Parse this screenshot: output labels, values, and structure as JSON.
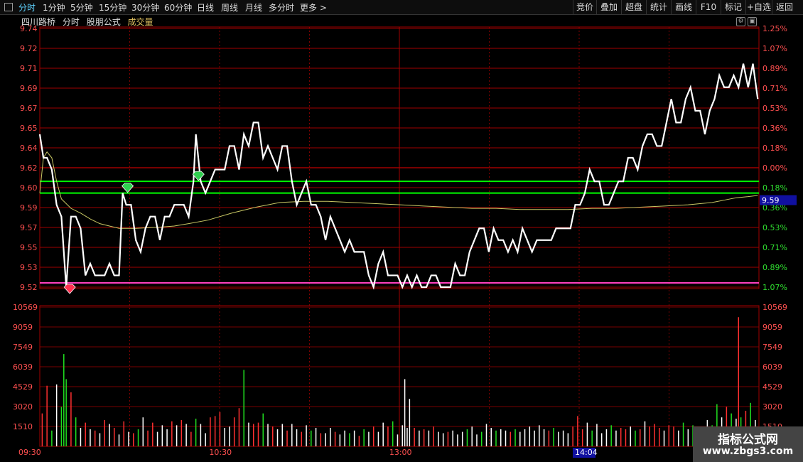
{
  "toolbar": {
    "tabs": [
      "分时",
      "1分钟",
      "5分钟",
      "15分钟",
      "30分钟",
      "60分钟",
      "日线",
      "周线",
      "月线",
      "多分时",
      "更多 >"
    ],
    "right_buttons": [
      "竞价",
      "叠加",
      "超盘",
      "统计",
      "画线",
      "F10",
      "标记",
      "+自选",
      "返回"
    ]
  },
  "title": {
    "stock": "四川路桥",
    "mode": "分时",
    "formula": "股朋公式",
    "volume_label": "成交量"
  },
  "colors": {
    "price_line": "#ffffff",
    "avg_line": "#c8c864",
    "grid_red": "#a00000",
    "axis_red": "#ff4040",
    "support_green": "#00ff00",
    "support_magenta": "#ff40c0",
    "vol_red": "#ff3030",
    "vol_green": "#20e020",
    "vol_white": "#ffffff",
    "current_price_box": "#1010a0"
  },
  "icons": {
    "up_marker": "green-diamond-icon",
    "down_marker": "red-diamond-icon"
  },
  "chart_data": {
    "type": "line",
    "price_axis_labels": [
      "9.74",
      "9.72",
      "9.71",
      "9.69",
      "9.67",
      "9.65",
      "9.64",
      "9.62",
      "9.60",
      "9.59",
      "9.57",
      "9.55",
      "9.53",
      "9.52"
    ],
    "pct_axis_labels": [
      "1.25%",
      "1.07%",
      "0.89%",
      "0.71%",
      "0.53%",
      "0.36%",
      "0.18%",
      "0.00%",
      "0.18%",
      "0.36%",
      "0.53%",
      "0.71%",
      "0.89%",
      "1.07%"
    ],
    "volume_axis_labels": [
      "10569",
      "9059",
      "7549",
      "6039",
      "4529",
      "3020",
      "1510"
    ],
    "ylim": [
      9.52,
      9.74
    ],
    "volume_max": 10569,
    "time_labels": [
      "09:30",
      "10:30",
      "13:00",
      "14:04"
    ],
    "current_price": "9.59",
    "green_lines": [
      9.61,
      9.6
    ],
    "magenta_line": 9.52,
    "price_series": [
      [
        0,
        9.65
      ],
      [
        3,
        9.63
      ],
      [
        6,
        9.63
      ],
      [
        10,
        9.62
      ],
      [
        14,
        9.59
      ],
      [
        18,
        9.58
      ],
      [
        22,
        9.52
      ],
      [
        26,
        9.58
      ],
      [
        30,
        9.58
      ],
      [
        34,
        9.57
      ],
      [
        38,
        9.53
      ],
      [
        42,
        9.54
      ],
      [
        46,
        9.53
      ],
      [
        50,
        9.53
      ],
      [
        54,
        9.53
      ],
      [
        58,
        9.54
      ],
      [
        62,
        9.53
      ],
      [
        66,
        9.53
      ],
      [
        69,
        9.6
      ],
      [
        72,
        9.59
      ],
      [
        76,
        9.59
      ],
      [
        80,
        9.56
      ],
      [
        84,
        9.55
      ],
      [
        88,
        9.57
      ],
      [
        92,
        9.58
      ],
      [
        96,
        9.58
      ],
      [
        100,
        9.56
      ],
      [
        104,
        9.58
      ],
      [
        108,
        9.58
      ],
      [
        112,
        9.59
      ],
      [
        116,
        9.59
      ],
      [
        120,
        9.59
      ],
      [
        124,
        9.58
      ],
      [
        128,
        9.61
      ],
      [
        130,
        9.65
      ],
      [
        134,
        9.61
      ],
      [
        138,
        9.6
      ],
      [
        142,
        9.61
      ],
      [
        146,
        9.62
      ],
      [
        150,
        9.62
      ],
      [
        154,
        9.62
      ],
      [
        158,
        9.64
      ],
      [
        162,
        9.64
      ],
      [
        166,
        9.62
      ],
      [
        170,
        9.65
      ],
      [
        174,
        9.64
      ],
      [
        178,
        9.66
      ],
      [
        182,
        9.66
      ],
      [
        186,
        9.63
      ],
      [
        190,
        9.64
      ],
      [
        194,
        9.63
      ],
      [
        198,
        9.62
      ],
      [
        202,
        9.64
      ],
      [
        206,
        9.64
      ],
      [
        210,
        9.61
      ],
      [
        214,
        9.59
      ],
      [
        218,
        9.6
      ],
      [
        222,
        9.61
      ],
      [
        226,
        9.59
      ],
      [
        230,
        9.59
      ],
      [
        234,
        9.58
      ],
      [
        238,
        9.56
      ],
      [
        242,
        9.58
      ],
      [
        246,
        9.57
      ],
      [
        250,
        9.56
      ],
      [
        254,
        9.55
      ],
      [
        258,
        9.56
      ],
      [
        262,
        9.55
      ],
      [
        266,
        9.55
      ],
      [
        270,
        9.55
      ],
      [
        274,
        9.53
      ],
      [
        278,
        9.52
      ],
      [
        282,
        9.54
      ],
      [
        286,
        9.55
      ],
      [
        290,
        9.53
      ],
      [
        294,
        9.53
      ],
      [
        298,
        9.53
      ],
      [
        302,
        9.52
      ],
      [
        306,
        9.53
      ],
      [
        310,
        9.52
      ],
      [
        314,
        9.53
      ],
      [
        318,
        9.52
      ],
      [
        322,
        9.52
      ],
      [
        326,
        9.53
      ],
      [
        330,
        9.53
      ],
      [
        334,
        9.52
      ],
      [
        338,
        9.52
      ],
      [
        342,
        9.52
      ],
      [
        346,
        9.54
      ],
      [
        350,
        9.53
      ],
      [
        354,
        9.53
      ],
      [
        358,
        9.55
      ],
      [
        362,
        9.56
      ],
      [
        366,
        9.57
      ],
      [
        370,
        9.57
      ],
      [
        374,
        9.55
      ],
      [
        378,
        9.57
      ],
      [
        382,
        9.56
      ],
      [
        386,
        9.56
      ],
      [
        390,
        9.55
      ],
      [
        394,
        9.56
      ],
      [
        398,
        9.55
      ],
      [
        402,
        9.57
      ],
      [
        406,
        9.56
      ],
      [
        410,
        9.55
      ],
      [
        414,
        9.56
      ],
      [
        418,
        9.56
      ],
      [
        422,
        9.56
      ],
      [
        426,
        9.56
      ],
      [
        430,
        9.57
      ],
      [
        434,
        9.57
      ],
      [
        438,
        9.57
      ],
      [
        442,
        9.57
      ],
      [
        446,
        9.59
      ],
      [
        450,
        9.59
      ],
      [
        454,
        9.6
      ],
      [
        458,
        9.62
      ],
      [
        462,
        9.61
      ],
      [
        466,
        9.61
      ],
      [
        470,
        9.59
      ],
      [
        474,
        9.59
      ],
      [
        478,
        9.6
      ],
      [
        482,
        9.61
      ],
      [
        486,
        9.61
      ],
      [
        490,
        9.63
      ],
      [
        494,
        9.63
      ],
      [
        498,
        9.62
      ],
      [
        502,
        9.64
      ],
      [
        506,
        9.65
      ],
      [
        510,
        9.65
      ],
      [
        514,
        9.64
      ],
      [
        518,
        9.64
      ],
      [
        522,
        9.66
      ],
      [
        526,
        9.68
      ],
      [
        530,
        9.66
      ],
      [
        534,
        9.66
      ],
      [
        538,
        9.68
      ],
      [
        542,
        9.69
      ],
      [
        546,
        9.67
      ],
      [
        550,
        9.67
      ],
      [
        554,
        9.65
      ],
      [
        558,
        9.67
      ],
      [
        562,
        9.68
      ],
      [
        566,
        9.7
      ],
      [
        570,
        9.69
      ],
      [
        574,
        9.69
      ],
      [
        578,
        9.7
      ],
      [
        582,
        9.69
      ],
      [
        586,
        9.71
      ],
      [
        590,
        9.69
      ],
      [
        594,
        9.71
      ],
      [
        598,
        9.68
      ]
    ],
    "avg_series": [
      [
        0,
        9.6
      ],
      [
        3,
        9.63
      ],
      [
        6,
        9.635
      ],
      [
        10,
        9.63
      ],
      [
        14,
        9.61
      ],
      [
        18,
        9.595
      ],
      [
        26,
        9.587
      ],
      [
        34,
        9.583
      ],
      [
        42,
        9.578
      ],
      [
        50,
        9.574
      ],
      [
        58,
        9.572
      ],
      [
        66,
        9.57
      ],
      [
        80,
        9.57
      ],
      [
        100,
        9.571
      ],
      [
        112,
        9.572
      ],
      [
        124,
        9.574
      ],
      [
        140,
        9.577
      ],
      [
        160,
        9.583
      ],
      [
        180,
        9.588
      ],
      [
        200,
        9.592
      ],
      [
        220,
        9.593
      ],
      [
        240,
        9.593
      ],
      [
        260,
        9.592
      ],
      [
        280,
        9.591
      ],
      [
        300,
        9.59
      ],
      [
        320,
        9.589
      ],
      [
        340,
        9.588
      ],
      [
        360,
        9.587
      ],
      [
        380,
        9.587
      ],
      [
        400,
        9.586
      ],
      [
        420,
        9.586
      ],
      [
        440,
        9.586
      ],
      [
        460,
        9.587
      ],
      [
        480,
        9.587
      ],
      [
        500,
        9.588
      ],
      [
        520,
        9.589
      ],
      [
        540,
        9.59
      ],
      [
        560,
        9.592
      ],
      [
        570,
        9.594
      ],
      [
        580,
        9.596
      ],
      [
        590,
        9.597
      ],
      [
        598,
        9.598
      ]
    ],
    "volume_bars": [
      [
        2,
        2500,
        "r"
      ],
      [
        6,
        4600,
        "r"
      ],
      [
        10,
        1200,
        "g"
      ],
      [
        14,
        4700,
        "w"
      ],
      [
        18,
        3000,
        "g"
      ],
      [
        20,
        7000,
        "g"
      ],
      [
        22,
        5100,
        "g"
      ],
      [
        26,
        4100,
        "r"
      ],
      [
        30,
        2200,
        "g"
      ],
      [
        34,
        1400,
        "w"
      ],
      [
        38,
        1800,
        "r"
      ],
      [
        42,
        1300,
        "w"
      ],
      [
        46,
        1200,
        "r"
      ],
      [
        50,
        1000,
        "w"
      ],
      [
        54,
        2000,
        "r"
      ],
      [
        58,
        1700,
        "w"
      ],
      [
        62,
        1400,
        "r"
      ],
      [
        66,
        900,
        "w"
      ],
      [
        70,
        1900,
        "r"
      ],
      [
        74,
        1100,
        "w"
      ],
      [
        78,
        1000,
        "r"
      ],
      [
        82,
        1300,
        "g"
      ],
      [
        86,
        2200,
        "w"
      ],
      [
        90,
        1200,
        "r"
      ],
      [
        94,
        1800,
        "r"
      ],
      [
        98,
        1100,
        "w"
      ],
      [
        102,
        1600,
        "w"
      ],
      [
        106,
        1300,
        "w"
      ],
      [
        110,
        1900,
        "r"
      ],
      [
        114,
        1600,
        "w"
      ],
      [
        118,
        2000,
        "r"
      ],
      [
        122,
        1700,
        "w"
      ],
      [
        126,
        1100,
        "r"
      ],
      [
        130,
        2100,
        "g"
      ],
      [
        134,
        1700,
        "w"
      ],
      [
        138,
        1000,
        "w"
      ],
      [
        142,
        2200,
        "r"
      ],
      [
        146,
        2300,
        "r"
      ],
      [
        150,
        2600,
        "r"
      ],
      [
        154,
        1400,
        "w"
      ],
      [
        158,
        1500,
        "w"
      ],
      [
        162,
        2200,
        "r"
      ],
      [
        166,
        2900,
        "r"
      ],
      [
        170,
        5800,
        "g"
      ],
      [
        174,
        1800,
        "w"
      ],
      [
        178,
        1700,
        "r"
      ],
      [
        182,
        1800,
        "r"
      ],
      [
        186,
        2500,
        "g"
      ],
      [
        190,
        1700,
        "w"
      ],
      [
        194,
        1500,
        "r"
      ],
      [
        198,
        1300,
        "w"
      ],
      [
        202,
        1700,
        "w"
      ],
      [
        206,
        1200,
        "r"
      ],
      [
        210,
        1700,
        "w"
      ],
      [
        214,
        1300,
        "w"
      ],
      [
        218,
        1100,
        "r"
      ],
      [
        222,
        1600,
        "w"
      ],
      [
        226,
        1200,
        "g"
      ],
      [
        230,
        1400,
        "w"
      ],
      [
        234,
        1000,
        "r"
      ],
      [
        238,
        1000,
        "w"
      ],
      [
        242,
        1400,
        "w"
      ],
      [
        246,
        1100,
        "r"
      ],
      [
        250,
        900,
        "w"
      ],
      [
        254,
        1200,
        "w"
      ],
      [
        258,
        1000,
        "g"
      ],
      [
        262,
        1200,
        "w"
      ],
      [
        266,
        800,
        "r"
      ],
      [
        270,
        1300,
        "g"
      ],
      [
        274,
        1100,
        "w"
      ],
      [
        278,
        1500,
        "r"
      ],
      [
        282,
        1100,
        "w"
      ],
      [
        286,
        1800,
        "w"
      ],
      [
        290,
        1500,
        "r"
      ],
      [
        294,
        1900,
        "g"
      ],
      [
        298,
        900,
        "w"
      ],
      [
        302,
        1600,
        "w"
      ],
      [
        304,
        5100,
        "w"
      ],
      [
        306,
        1400,
        "w"
      ],
      [
        308,
        3600,
        "w"
      ],
      [
        312,
        1400,
        "r"
      ],
      [
        316,
        1200,
        "w"
      ],
      [
        320,
        1300,
        "r"
      ],
      [
        324,
        1200,
        "w"
      ],
      [
        328,
        1500,
        "r"
      ],
      [
        332,
        1100,
        "w"
      ],
      [
        336,
        1000,
        "w"
      ],
      [
        340,
        1100,
        "r"
      ],
      [
        344,
        1200,
        "w"
      ],
      [
        348,
        900,
        "w"
      ],
      [
        352,
        1100,
        "w"
      ],
      [
        356,
        1300,
        "g"
      ],
      [
        360,
        1500,
        "w"
      ],
      [
        364,
        900,
        "w"
      ],
      [
        368,
        1100,
        "g"
      ],
      [
        372,
        1700,
        "w"
      ],
      [
        376,
        1400,
        "w"
      ],
      [
        380,
        1200,
        "g"
      ],
      [
        384,
        1300,
        "w"
      ],
      [
        388,
        1200,
        "w"
      ],
      [
        392,
        1100,
        "r"
      ],
      [
        396,
        1300,
        "g"
      ],
      [
        400,
        1100,
        "w"
      ],
      [
        404,
        1300,
        "w"
      ],
      [
        408,
        1500,
        "w"
      ],
      [
        412,
        1200,
        "w"
      ],
      [
        416,
        1600,
        "w"
      ],
      [
        420,
        1300,
        "w"
      ],
      [
        424,
        1200,
        "r"
      ],
      [
        428,
        1400,
        "g"
      ],
      [
        432,
        1100,
        "w"
      ],
      [
        436,
        1200,
        "w"
      ],
      [
        440,
        1000,
        "w"
      ],
      [
        444,
        1500,
        "r"
      ],
      [
        448,
        2300,
        "r"
      ],
      [
        452,
        1300,
        "r"
      ],
      [
        456,
        1800,
        "w"
      ],
      [
        460,
        1200,
        "g"
      ],
      [
        464,
        1700,
        "w"
      ],
      [
        468,
        1000,
        "w"
      ],
      [
        472,
        1300,
        "w"
      ],
      [
        476,
        1600,
        "g"
      ],
      [
        480,
        1200,
        "w"
      ],
      [
        484,
        1400,
        "r"
      ],
      [
        488,
        1300,
        "r"
      ],
      [
        492,
        1500,
        "w"
      ],
      [
        496,
        1200,
        "g"
      ],
      [
        500,
        1300,
        "r"
      ],
      [
        504,
        1900,
        "w"
      ],
      [
        508,
        1500,
        "r"
      ],
      [
        512,
        1700,
        "r"
      ],
      [
        516,
        1400,
        "r"
      ],
      [
        520,
        1200,
        "w"
      ],
      [
        524,
        1600,
        "r"
      ],
      [
        528,
        1500,
        "r"
      ],
      [
        532,
        1200,
        "w"
      ],
      [
        536,
        1800,
        "g"
      ],
      [
        540,
        1300,
        "w"
      ],
      [
        544,
        1600,
        "g"
      ],
      [
        548,
        1500,
        "w"
      ],
      [
        552,
        1400,
        "r"
      ],
      [
        556,
        2000,
        "w"
      ],
      [
        560,
        1600,
        "g"
      ],
      [
        564,
        3200,
        "g"
      ],
      [
        568,
        2200,
        "w"
      ],
      [
        572,
        3000,
        "r"
      ],
      [
        576,
        2500,
        "g"
      ],
      [
        580,
        2100,
        "w"
      ],
      [
        582,
        9800,
        "r"
      ],
      [
        584,
        2200,
        "g"
      ],
      [
        588,
        2700,
        "r"
      ],
      [
        592,
        3300,
        "g"
      ],
      [
        596,
        2000,
        "w"
      ]
    ]
  }
}
